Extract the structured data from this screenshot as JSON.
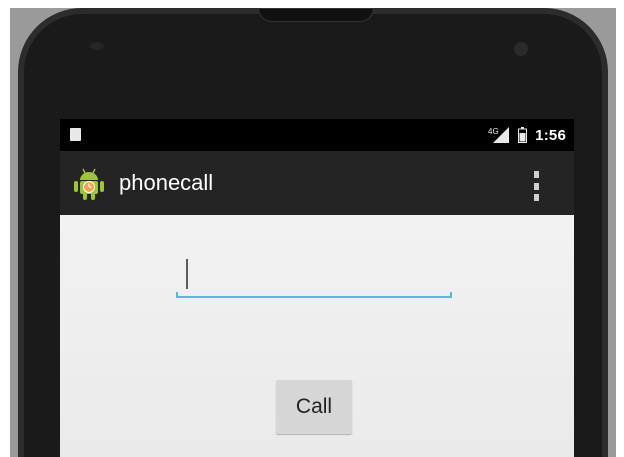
{
  "status_bar": {
    "time": "1:56",
    "signal_label": "4G",
    "left_icon": "sd-card-icon",
    "signal_icon": "cell-signal-icon",
    "battery_icon": "battery-icon"
  },
  "action_bar": {
    "app_icon": "android-robot-icon",
    "title": "phonecall",
    "overflow_icon": "overflow-menu-icon"
  },
  "main": {
    "phone_input": {
      "value": "",
      "placeholder": ""
    },
    "call_button_label": "Call"
  },
  "colors": {
    "status_bar": "#000000",
    "action_bar": "#242424",
    "screen_bg": "#efefef",
    "input_underline": "#58b7da",
    "button_bg": "#d6d6d6",
    "android_green": "#9dc43a"
  }
}
